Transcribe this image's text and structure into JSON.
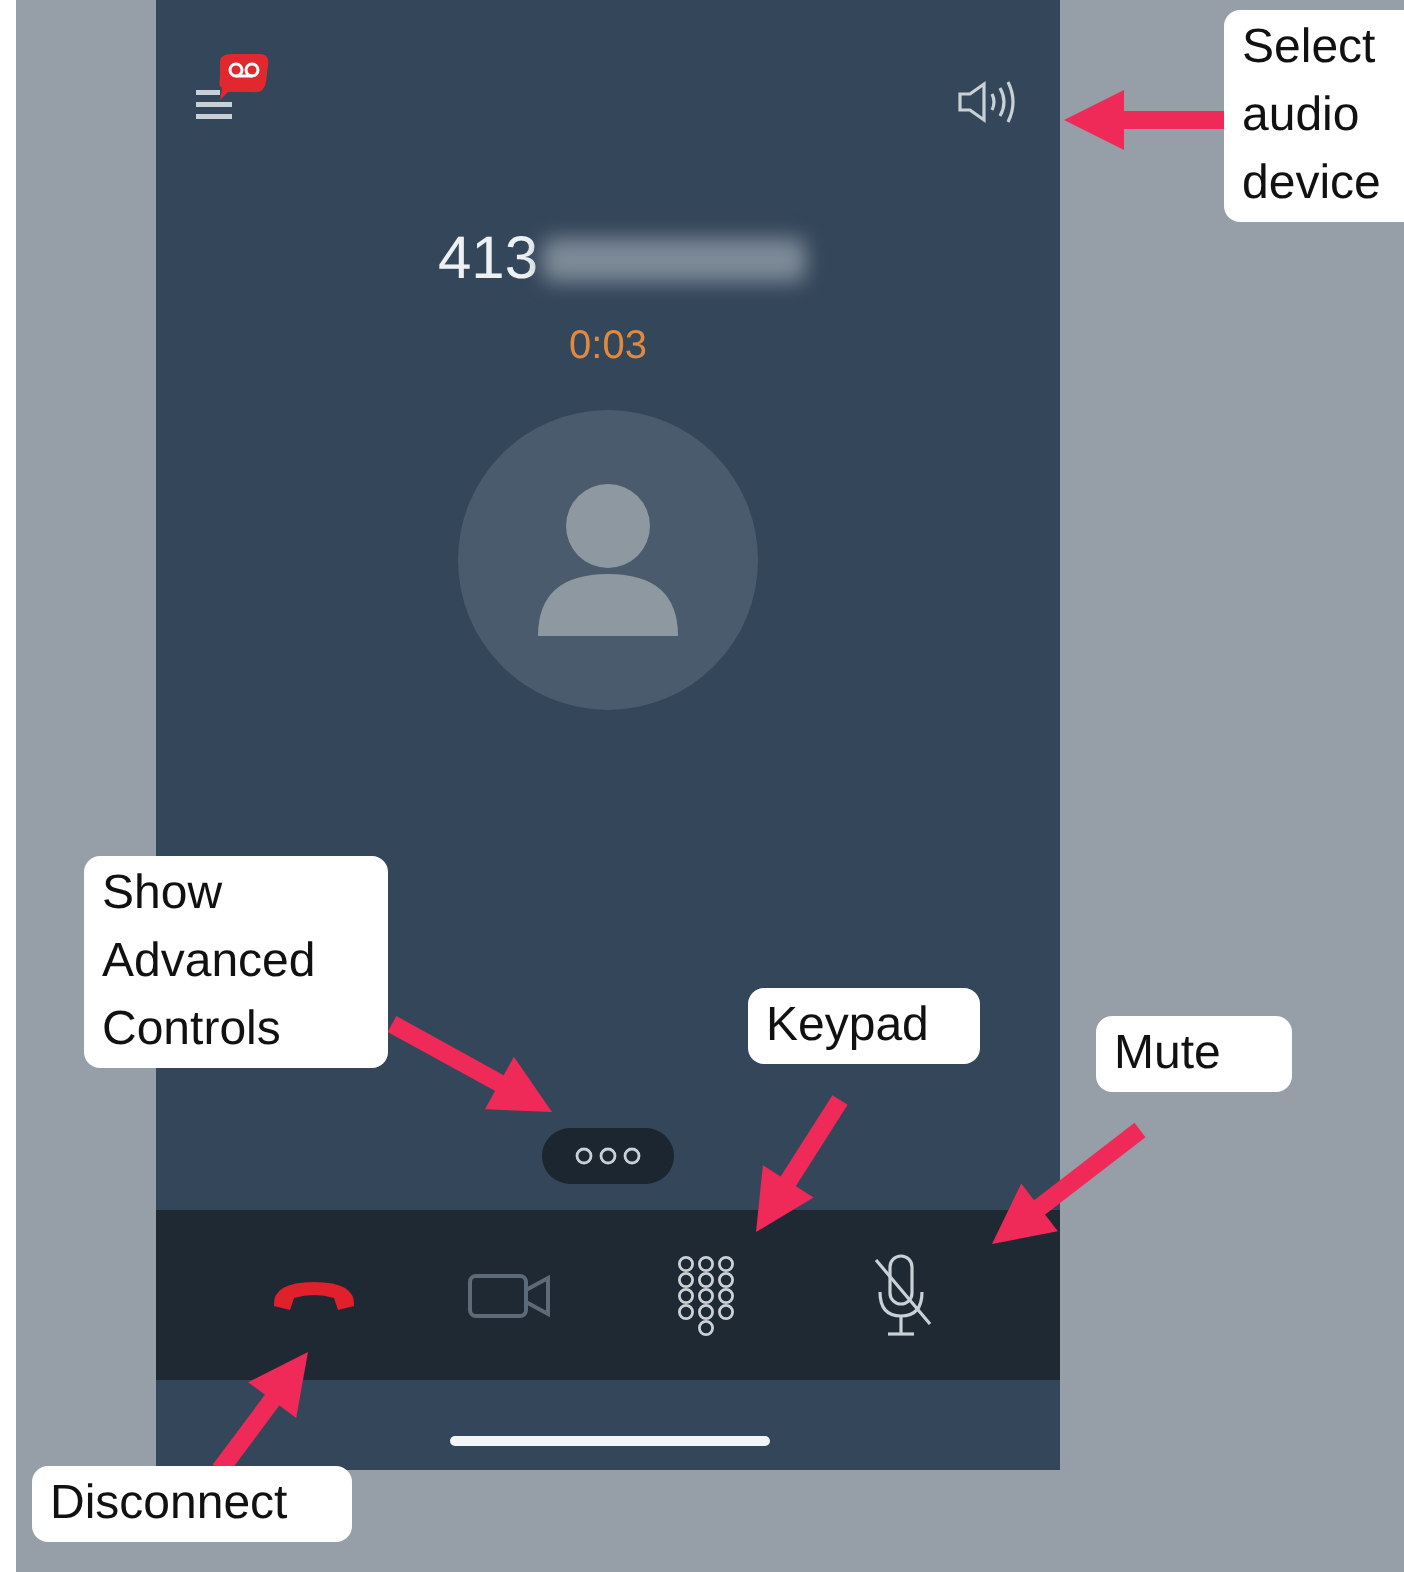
{
  "call": {
    "number": "413",
    "timer": "0:03"
  },
  "controls": [
    {
      "kind": "hangup",
      "disabled": false
    },
    {
      "kind": "video",
      "disabled": true
    },
    {
      "kind": "keypad",
      "disabled": false
    },
    {
      "kind": "mute",
      "disabled": false
    }
  ],
  "callouts": [
    {
      "kind": "audio",
      "text": "Select audio device"
    },
    {
      "kind": "advanced",
      "text": "Show Advanced Controls"
    },
    {
      "kind": "keypad",
      "text": "Keypad"
    },
    {
      "kind": "mute",
      "text": "Mute"
    },
    {
      "kind": "disconnect",
      "text": "Disconnect"
    }
  ]
}
